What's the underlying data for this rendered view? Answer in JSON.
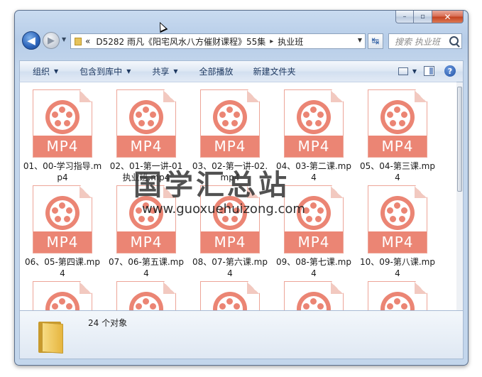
{
  "window": {
    "minimize_symbol": "–",
    "maximize_symbol": "▫",
    "close_symbol": "✕"
  },
  "nav": {
    "back_symbol": "◀",
    "forward_symbol": "▶",
    "path_prefix": "«",
    "path_folder": "D5282 雨凡《阳宅风水八方催财课程》55集",
    "path_sep": "▸",
    "path_current": "执业班",
    "refresh_symbol": "↹",
    "search_placeholder": "搜索 执业班"
  },
  "toolbar": {
    "organize": "组织",
    "include_library": "包含到库中",
    "share": "共享",
    "play_all": "全部播放",
    "new_folder": "新建文件夹",
    "help_symbol": "?"
  },
  "file_badge": "MP4",
  "files": [
    {
      "name": "01、00-学习指导.mp4"
    },
    {
      "name": "02、01-第一讲-01执业班.mp4"
    },
    {
      "name": "03、02-第一讲-02.mp4"
    },
    {
      "name": "04、03-第二课.mp4"
    },
    {
      "name": "05、04-第三课.mp4"
    },
    {
      "name": "06、05-第四课.mp4"
    },
    {
      "name": "07、06-第五课.mp4"
    },
    {
      "name": "08、07-第六课.mp4"
    },
    {
      "name": "09、08-第七课.mp4"
    },
    {
      "name": "10、09-第八课.mp4"
    },
    {
      "name": ""
    },
    {
      "name": ""
    },
    {
      "name": ""
    },
    {
      "name": ""
    },
    {
      "name": ""
    }
  ],
  "watermark": {
    "title": "国学汇总站",
    "url": "www.guoxuehuizong.com"
  },
  "details": {
    "count": "24 个对象"
  },
  "colors": {
    "accent": "#eb8574",
    "frame": "#c3d6ec"
  }
}
